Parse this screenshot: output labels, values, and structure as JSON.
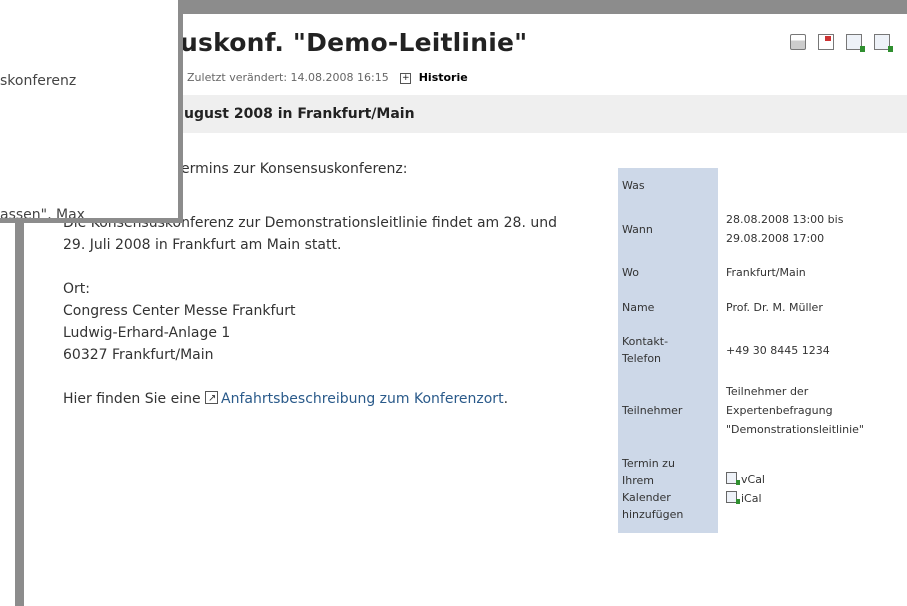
{
  "page": {
    "title": "uskonf. \"Demo-Leitlinie\"",
    "meta": {
      "modified": "Zuletzt verändert: 14.08.2008 16:15",
      "history_label": "Historie"
    },
    "subheader": "ugust 2008 in Frankfurt/Main",
    "intro": "ermins zur Konsensuskonferenz:"
  },
  "toolbar": {
    "icons": [
      "print-icon",
      "window-icon",
      "calendar-download-icon",
      "calendar-download-icon"
    ]
  },
  "body": {
    "para1_line1": "Die Konsensuskonferenz zur Demonstrationsleitlinie findet am 28. und",
    "para1_line2": "29. Juli 2008 in Frankfurt am Main statt.",
    "ort_label": "Ort:",
    "address": [
      "Congress Center Messe Frankfurt",
      "Ludwig-Erhard-Anlage 1",
      "60327 Frankfurt/Main"
    ],
    "directions_prefix": "Hier finden Sie eine ",
    "directions_link": "Anfahrtsbeschreibung zum Konferenzort",
    "directions_suffix": "."
  },
  "info": {
    "was_label": "Was",
    "was_value": "",
    "wann_label": "Wann",
    "wann_value_1": "28.08.2008 13:00 bis",
    "wann_value_2": "29.08.2008 17:00",
    "wo_label": "Wo",
    "wo_value": "Frankfurt/Main",
    "name_label": "Name",
    "name_value": "Prof. Dr. M. Müller",
    "kontakt_label_1": "Kontakt-",
    "kontakt_label_2": "Telefon",
    "kontakt_value": "+49 30 8445 1234",
    "teilnehmer_label": "Teilnehmer",
    "teilnehmer_value_1": "Teilnehmer der",
    "teilnehmer_value_2": "Expertenbefragung",
    "teilnehmer_value_3": "\"Demonstrationsleitlinie\"",
    "termin_label_1": "Termin zu",
    "termin_label_2": "Ihrem",
    "termin_label_3": "Kalender",
    "termin_label_4": "hinzufügen",
    "vcal": "vCal",
    "ical": "iCal"
  },
  "popup": {
    "line1": "skonferenz",
    "line2": "assen\", Max"
  },
  "colors": {
    "frame": "#8c8c8c",
    "label_bg": "#cdd8e8",
    "subheader_bg": "#efefef",
    "link": "#2a5a8a"
  }
}
